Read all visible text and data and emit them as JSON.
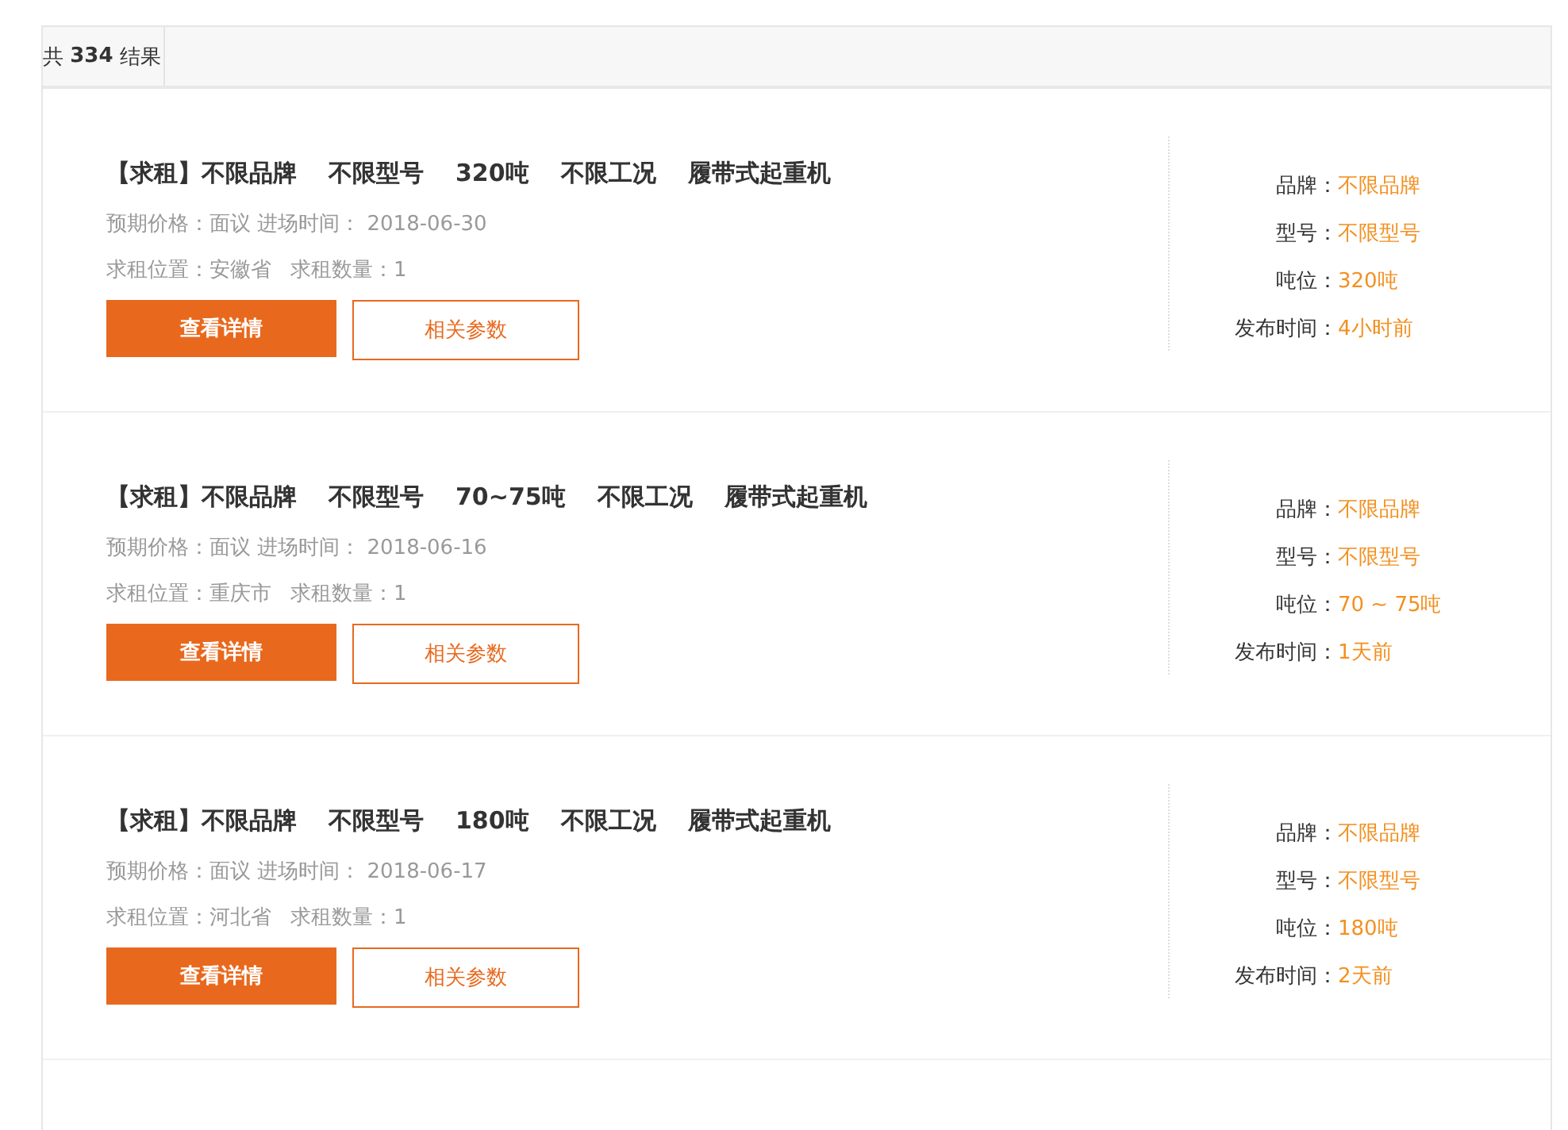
{
  "summary_tab": {
    "label": "共 **334** 结果"
  },
  "listings": [
    {
      "title_parts": [
        "【求租】不限品牌",
        "不限型号",
        "320吨",
        "不限工况",
        "履带式起重机"
      ],
      "price_line": "预期价格：面议 进场时间： 2018-06-30",
      "location_line": "求租位置：安徽省",
      "quantity_line": "求租数量：1",
      "detail_button": "查看详情",
      "params_button": "相关参数",
      "specs": [
        {
          "label": "品牌：",
          "value": "不限品牌"
        },
        {
          "label": "型号：",
          "value": "不限型号"
        },
        {
          "label": "吨位：",
          "value": "320吨"
        },
        {
          "label": "发布时间：",
          "value": "4小时前"
        }
      ]
    },
    {
      "title_parts": [
        "【求租】不限品牌",
        "不限型号",
        "70~75吨",
        "不限工况",
        "履带式起重机"
      ],
      "price_line": "预期价格：面议 进场时间： 2018-06-16",
      "location_line": "求租位置：重庆市",
      "quantity_line": "求租数量：1",
      "detail_button": "查看详情",
      "params_button": "相关参数",
      "specs": [
        {
          "label": "品牌：",
          "value": "不限品牌"
        },
        {
          "label": "型号：",
          "value": "不限型号"
        },
        {
          "label": "吨位：",
          "value": "70 ~ 75吨"
        },
        {
          "label": "发布时间：",
          "value": "1天前"
        }
      ]
    },
    {
      "title_parts": [
        "【求租】不限品牌",
        "不限型号",
        "180吨",
        "不限工况",
        "履带式起重机"
      ],
      "price_line": "预期价格：面议 进场时间： 2018-06-17",
      "location_line": "求租位置：河北省",
      "quantity_line": "求租数量：1",
      "detail_button": "查看详情",
      "params_button": "相关参数",
      "specs": [
        {
          "label": "品牌：",
          "value": "不限品牌"
        },
        {
          "label": "型号：",
          "value": "不限型号"
        },
        {
          "label": "吨位：",
          "value": "180吨"
        },
        {
          "label": "发布时间：",
          "value": "2天前"
        }
      ]
    }
  ]
}
